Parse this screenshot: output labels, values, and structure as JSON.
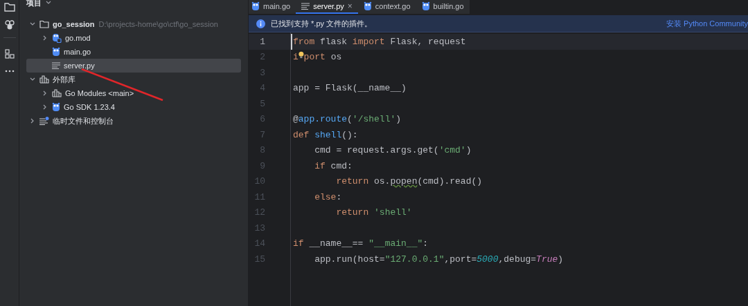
{
  "sidebar": {
    "title": "项目"
  },
  "tree": [
    {
      "label": "go_session",
      "path": "D:\\projects-home\\go\\ctf\\go_session",
      "kind": "folder",
      "expanded": true,
      "selected": false,
      "children": [
        {
          "label": "go.mod",
          "kind": "gomod",
          "expanded": false,
          "selected": false
        },
        {
          "label": "main.go",
          "kind": "gofile",
          "selected": false
        },
        {
          "label": "server.py",
          "kind": "textfile",
          "selected": true
        }
      ]
    },
    {
      "label": "外部库",
      "kind": "library",
      "expanded": true,
      "selected": false,
      "children": [
        {
          "label": "Go Modules <main>",
          "kind": "library",
          "expanded": false,
          "selected": false
        },
        {
          "label": "Go SDK 1.23.4",
          "kind": "gofile",
          "expanded": false,
          "selected": false
        }
      ]
    },
    {
      "label": "临时文件和控制台",
      "kind": "scratches",
      "expanded": false,
      "selected": false
    }
  ],
  "tabs": [
    {
      "label": "main.go",
      "kind": "gofile",
      "selected": false
    },
    {
      "label": "server.py",
      "kind": "textfile",
      "selected": true,
      "close": "×"
    },
    {
      "label": "context.go",
      "kind": "gofile",
      "selected": false
    },
    {
      "label": "builtin.go",
      "kind": "gofile",
      "selected": false
    }
  ],
  "banner": {
    "message": "已找到支持 *.py 文件的插件。",
    "action": "安装 Python Community"
  },
  "code": [
    {
      "number": "1",
      "current": true,
      "tokens": [
        {
          "text": "from",
          "kind": "keyword"
        },
        {
          "text": " flask ",
          "kind": "plain"
        },
        {
          "text": "import",
          "kind": "keyword"
        },
        {
          "text": " Flask, request",
          "kind": "plain"
        }
      ]
    },
    {
      "number": "2",
      "current": false,
      "tokens": [
        {
          "text": "i",
          "kind": "keyword"
        },
        {
          "kind": "bulb"
        },
        {
          "text": "port",
          "kind": "keyword"
        },
        {
          "text": " os",
          "kind": "plain"
        }
      ]
    },
    {
      "number": "3",
      "current": false
    },
    {
      "number": "4",
      "current": false,
      "tokens": [
        {
          "text": "app = Flask(__name__)",
          "kind": "plain"
        }
      ]
    },
    {
      "number": "5",
      "current": false
    },
    {
      "number": "6",
      "current": false,
      "tokens": [
        {
          "text": "@",
          "kind": "decorator"
        },
        {
          "text": "app.route",
          "kind": "function"
        },
        {
          "text": "(",
          "kind": "plain"
        },
        {
          "text": "'/shell'",
          "kind": "string"
        },
        {
          "text": ")",
          "kind": "plain"
        }
      ]
    },
    {
      "number": "7",
      "current": false,
      "tokens": [
        {
          "text": "def ",
          "kind": "keyword"
        },
        {
          "text": "shell",
          "kind": "function"
        },
        {
          "text": "():",
          "kind": "plain"
        }
      ]
    },
    {
      "number": "8",
      "current": false,
      "tokens": [
        {
          "text": "    cmd = request.args.get(",
          "kind": "plain"
        },
        {
          "text": "'cmd'",
          "kind": "string"
        },
        {
          "text": ")",
          "kind": "plain"
        }
      ]
    },
    {
      "number": "9",
      "current": false,
      "tokens": [
        {
          "text": "    if",
          "kind": "keyword"
        },
        {
          "text": " cmd:",
          "kind": "plain"
        }
      ]
    },
    {
      "number": "10",
      "current": false,
      "tokens": [
        {
          "text": "        return",
          "kind": "keyword"
        },
        {
          "text": " os.",
          "kind": "plain"
        },
        {
          "text": "popen",
          "kind": "warning"
        },
        {
          "text": "(cmd).read()",
          "kind": "plain"
        }
      ]
    },
    {
      "number": "11",
      "current": false,
      "tokens": [
        {
          "text": "    else",
          "kind": "keyword"
        },
        {
          "text": ":",
          "kind": "plain"
        }
      ]
    },
    {
      "number": "12",
      "current": false,
      "tokens": [
        {
          "text": "        return ",
          "kind": "keyword"
        },
        {
          "text": "'shell'",
          "kind": "string"
        }
      ]
    },
    {
      "number": "13",
      "current": false
    },
    {
      "number": "14",
      "current": false,
      "tokens": [
        {
          "text": "if",
          "kind": "keyword"
        },
        {
          "text": " __name__== ",
          "kind": "plain"
        },
        {
          "text": "\"__main__\"",
          "kind": "string"
        },
        {
          "text": ":",
          "kind": "plain"
        }
      ]
    },
    {
      "number": "15",
      "current": false,
      "tokens": [
        {
          "text": "    app.run(host=",
          "kind": "plain"
        },
        {
          "text": "\"127.0.0.1\"",
          "kind": "string"
        },
        {
          "text": ",port=",
          "kind": "plain"
        },
        {
          "text": "5000",
          "kind": "number"
        },
        {
          "text": ",debug=",
          "kind": "plain"
        },
        {
          "text": "True",
          "kind": "constant"
        },
        {
          "text": ")",
          "kind": "plain"
        }
      ]
    }
  ]
}
